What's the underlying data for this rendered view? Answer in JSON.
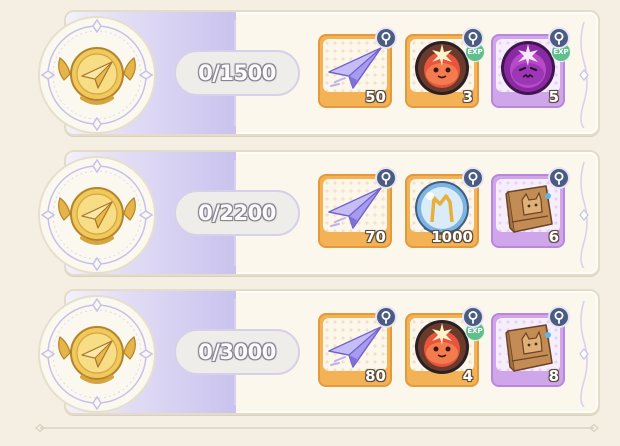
{
  "rows": [
    {
      "progress": "0/1500",
      "items": [
        {
          "kind": "paper-plane",
          "frame": "orange",
          "qty": "50",
          "exp": false
        },
        {
          "kind": "orange-slime",
          "frame": "orange",
          "qty": "3",
          "exp": true,
          "exp_label": "EXP"
        },
        {
          "kind": "purple-slime",
          "frame": "purple",
          "qty": "5",
          "exp": true,
          "exp_label": "EXP"
        }
      ]
    },
    {
      "progress": "0/2200",
      "items": [
        {
          "kind": "paper-plane",
          "frame": "orange",
          "qty": "70",
          "exp": false
        },
        {
          "kind": "crystal-orb",
          "frame": "orange",
          "qty": "1000",
          "exp": false
        },
        {
          "kind": "cat-book",
          "frame": "purple",
          "qty": "6",
          "exp": false
        }
      ]
    },
    {
      "progress": "0/3000",
      "items": [
        {
          "kind": "paper-plane",
          "frame": "orange",
          "qty": "80",
          "exp": false
        },
        {
          "kind": "orange-slime",
          "frame": "orange",
          "qty": "4",
          "exp": true,
          "exp_label": "EXP"
        },
        {
          "kind": "cat-book",
          "frame": "purple",
          "qty": "8",
          "exp": false
        }
      ]
    }
  ],
  "colors": {
    "background": "#f4efe2",
    "frame_orange": "#f3b255",
    "frame_purple": "#cfa6ea",
    "pin": "#4b5c82",
    "exp_badge": "#5fc08e",
    "lavender": "#c9c3ee"
  },
  "icons": [
    "paper-plane-medal-icon",
    "paper-plane-icon",
    "orange-slime-icon",
    "purple-slime-icon",
    "crystal-orb-icon",
    "cat-book-icon",
    "pin-icon",
    "exp-badge-icon"
  ]
}
